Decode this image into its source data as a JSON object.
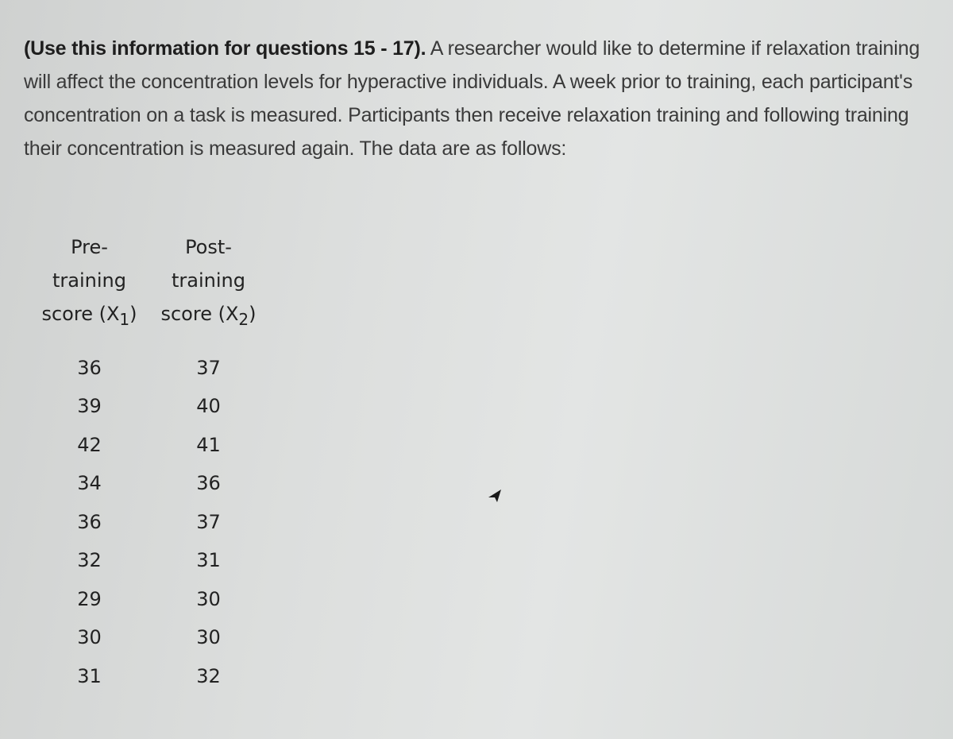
{
  "document": {
    "intro_bold": "(Use this information for questions 15 - 17).",
    "intro_text": " A researcher would like to determine if relaxation training will affect the concentration levels for hyperactive individuals.  A week prior to training, each participant's concentration on a task is measured.  Participants then receive relaxation training and following training their concentration is measured again.  The data are as follows:"
  },
  "table": {
    "columns": [
      {
        "line1": "Pre-",
        "line2": "training",
        "line3": "score (X",
        "sub": "1",
        "close": ")"
      },
      {
        "line1": "Post-",
        "line2": "training",
        "line3": "score (X",
        "sub": "2",
        "close": ")"
      }
    ],
    "pre": [
      "36",
      "39",
      "42",
      "34",
      "36",
      "32",
      "29",
      "30",
      "31"
    ],
    "post": [
      "37",
      "40",
      "41",
      "36",
      "37",
      "31",
      "30",
      "30",
      "32"
    ]
  }
}
